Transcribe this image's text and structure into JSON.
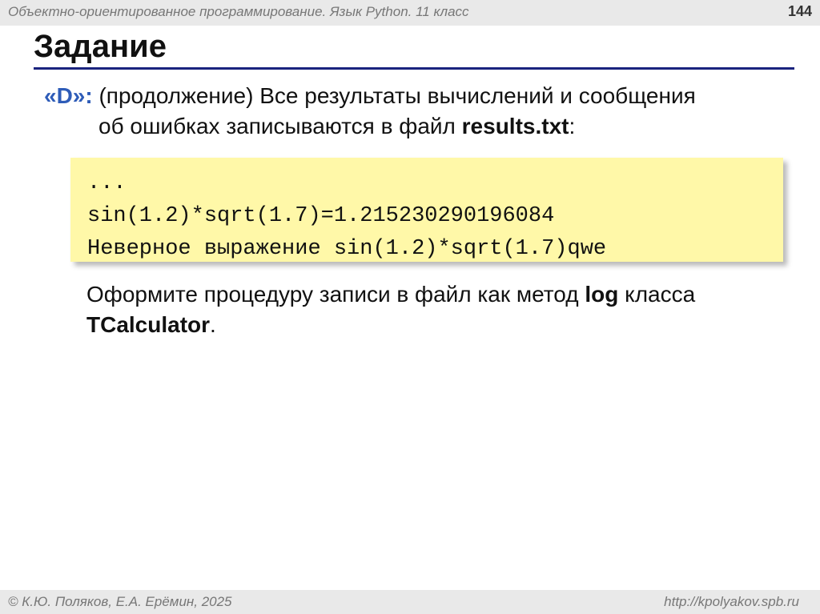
{
  "header": {
    "course": "Объектно-ориентированное программирование. Язык Python. 11 класс",
    "page_number": "144"
  },
  "title": "Задание",
  "task": {
    "label": "«D»:",
    "line1": " (продолжение) Все результаты вычислений и сообщения",
    "line2_start": "об ошибках записываются в файл ",
    "filename": "results.txt",
    "line2_end": ":"
  },
  "code": {
    "lines": [
      "...",
      "sin(1.2)*sqrt(1.7)=1.215230290196084",
      "Неверное выражение sin(1.2)*sqrt(1.7)qwe"
    ]
  },
  "note": {
    "text1": "Оформите процедуру записи в файл как метод ",
    "method": "log",
    "text2": " класса ",
    "class_name": "TCalculator",
    "text3": "."
  },
  "footer": {
    "copyright": "© К.Ю. Поляков, Е.А. Ерёмин, 2025",
    "url": "http://kpolyakov.spb.ru"
  },
  "colors": {
    "accent_blue": "#2e5cb8",
    "rule": "#1a237e",
    "code_background": "#fff8a8",
    "bar_background": "#e9e9e9"
  }
}
